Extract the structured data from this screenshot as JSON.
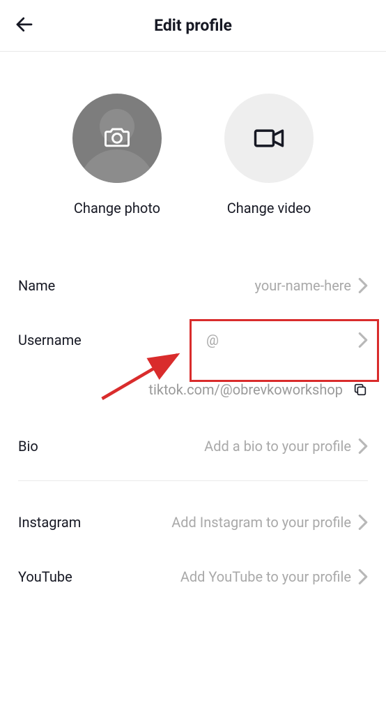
{
  "header": {
    "title": "Edit profile"
  },
  "media": {
    "photo_label": "Change photo",
    "video_label": "Change video"
  },
  "fields": {
    "name": {
      "label": "Name",
      "value": "your-name-here"
    },
    "username": {
      "label": "Username",
      "value": "@"
    },
    "bio": {
      "label": "Bio",
      "value": "Add a bio to your profile"
    },
    "instagram": {
      "label": "Instagram",
      "value": "Add Instagram to your profile"
    },
    "youtube": {
      "label": "YouTube",
      "value": "Add YouTube to your profile"
    }
  },
  "profile_url": "tiktok.com/@obrevkoworkshop"
}
